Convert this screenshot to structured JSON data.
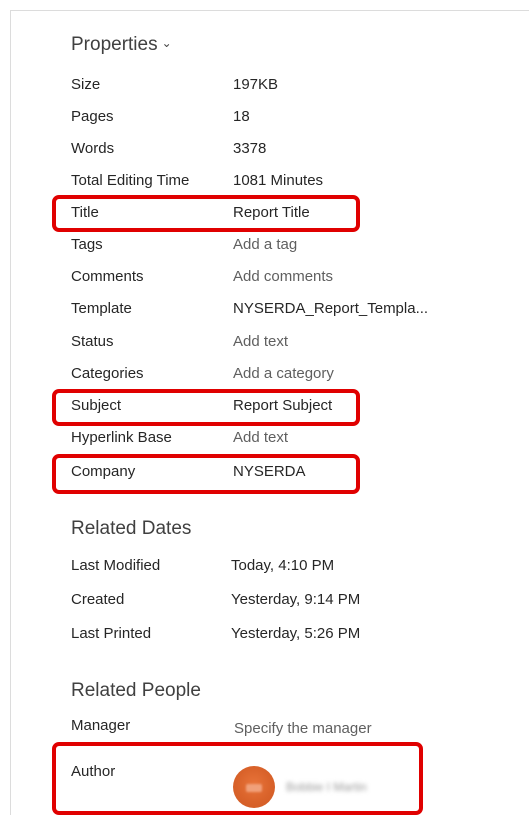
{
  "properties": {
    "heading": "Properties",
    "rows": [
      {
        "label": "Size",
        "value": "197KB"
      },
      {
        "label": "Pages",
        "value": "18"
      },
      {
        "label": "Words",
        "value": "3378"
      },
      {
        "label": "Total Editing Time",
        "value": "1081 Minutes"
      },
      {
        "label": "Title",
        "value": "Report Title"
      },
      {
        "label": "Tags",
        "value": "Add a tag"
      },
      {
        "label": "Comments",
        "value": "Add comments"
      },
      {
        "label": "Template",
        "value": "NYSERDA_Report_Templa..."
      },
      {
        "label": "Status",
        "value": "Add text"
      },
      {
        "label": "Categories",
        "value": "Add a category"
      },
      {
        "label": "Subject",
        "value": "Report Subject"
      },
      {
        "label": "Hyperlink Base",
        "value": "Add text"
      },
      {
        "label": "Company",
        "value": "NYSERDA"
      }
    ]
  },
  "related_dates": {
    "heading": "Related Dates",
    "rows": [
      {
        "label": "Last Modified",
        "value": "Today, 4:10 PM"
      },
      {
        "label": "Created",
        "value": "Yesterday, 9:14 PM"
      },
      {
        "label": "Last Printed",
        "value": "Yesterday, 5:26 PM"
      }
    ]
  },
  "related_people": {
    "heading": "Related People",
    "manager_label": "Manager",
    "manager_value": "Specify the manager",
    "author_label": "Author",
    "author_name": "Bobbie I Martin"
  },
  "icons": {
    "chevron": "chevron-down-icon",
    "avatar": "author-avatar"
  },
  "colors": {
    "highlight": "#e00000",
    "avatar": "#d9622a"
  }
}
